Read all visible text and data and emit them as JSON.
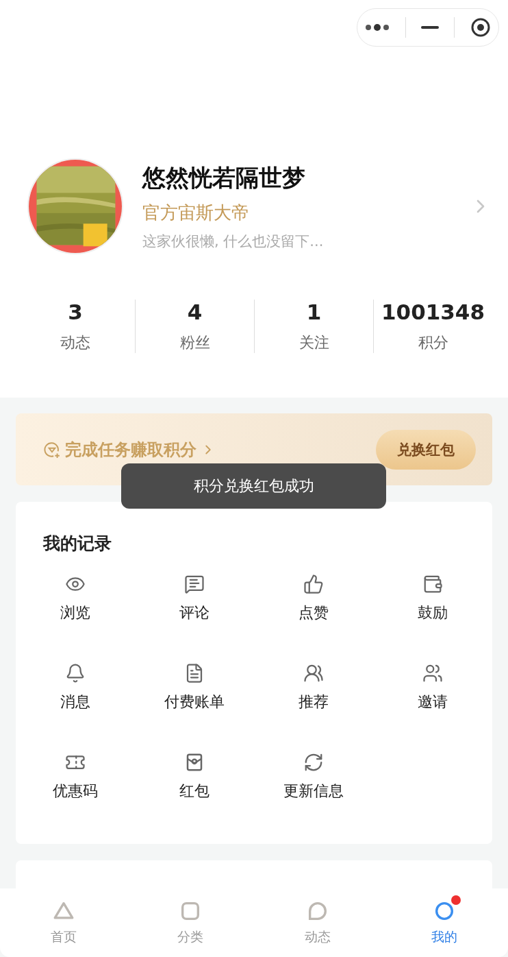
{
  "profile": {
    "name": "悠然恍若隔世梦",
    "title": "官方宙斯大帝",
    "bio": "这家伙很懒, 什么也没留下..."
  },
  "stats": [
    {
      "value": "3",
      "label": "动态"
    },
    {
      "value": "4",
      "label": "粉丝"
    },
    {
      "value": "1",
      "label": "关注"
    },
    {
      "value": "1001348",
      "label": "积分"
    }
  ],
  "task_banner": {
    "text": "完成任务赚取积分",
    "button": "兑换红包"
  },
  "toast": "积分兑换红包成功",
  "records": {
    "title": "我的记录",
    "items": [
      {
        "label": "浏览"
      },
      {
        "label": "评论"
      },
      {
        "label": "点赞"
      },
      {
        "label": "鼓励"
      },
      {
        "label": "消息"
      },
      {
        "label": "付费账单"
      },
      {
        "label": "推荐"
      },
      {
        "label": "邀请"
      },
      {
        "label": "优惠码"
      },
      {
        "label": "红包"
      },
      {
        "label": "更新信息"
      }
    ]
  },
  "tab_bar": [
    {
      "label": "首页",
      "selected": false,
      "badge": false
    },
    {
      "label": "分类",
      "selected": false,
      "badge": false
    },
    {
      "label": "动态",
      "selected": false,
      "badge": false
    },
    {
      "label": "我的",
      "selected": true,
      "badge": true
    }
  ]
}
